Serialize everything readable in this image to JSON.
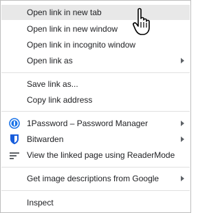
{
  "menu": {
    "open_new_tab": "Open link in new tab",
    "open_new_window": "Open link in new window",
    "open_incognito": "Open link in incognito window",
    "open_as": "Open link as",
    "save_as": "Save link as...",
    "copy_address": "Copy link address",
    "onepassword": "1Password – Password Manager",
    "bitwarden": "Bitwarden",
    "readermode": "View the linked page using ReaderMode",
    "image_descriptions": "Get image descriptions from Google",
    "inspect": "Inspect"
  },
  "icons": {
    "onepassword": "1password-icon",
    "bitwarden": "bitwarden-shield-icon",
    "readermode": "reader-lines-icon",
    "submenu": "chevron-right-icon",
    "cursor": "hand-pointer-icon"
  },
  "colors": {
    "hover_bg": "#e8e8e8",
    "text": "#202124",
    "border": "#bdbdbd",
    "onepassword_blue": "#1a73e8",
    "bitwarden_blue": "#175ddc",
    "reader_gray": "#5f6368"
  }
}
